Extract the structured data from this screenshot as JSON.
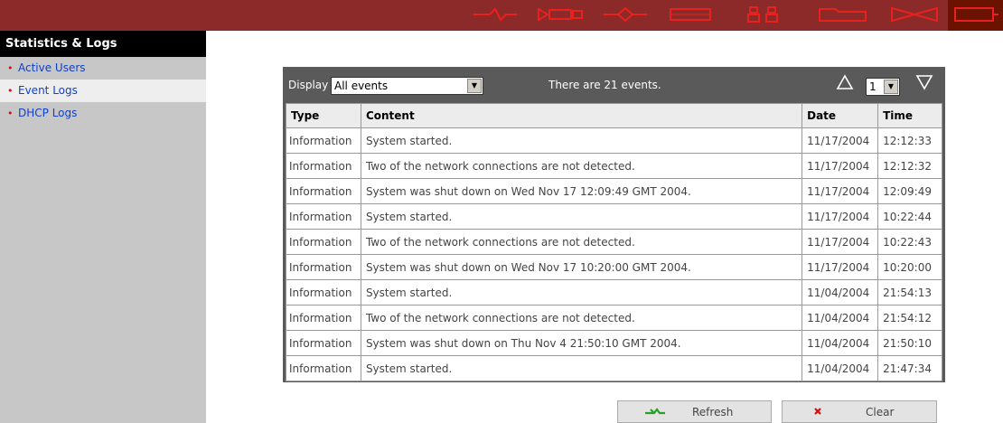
{
  "topnav": {
    "icons": [
      "network-plug-icon",
      "pipe-icon",
      "link-diamond-icon",
      "rectangle-bar-icon",
      "users-icon",
      "folder-icon",
      "bowtie-connector-icon",
      "monitor-icon"
    ],
    "icon_color": "#e8201e"
  },
  "sidebar": {
    "title": "Statistics & Logs",
    "items": [
      {
        "label": "Active Users"
      },
      {
        "label": "Event Logs"
      },
      {
        "label": "DHCP Logs"
      }
    ]
  },
  "toolbar": {
    "display_label": "Display",
    "display_value": "All events",
    "count_text": "There are 21 events.",
    "page_value": "1"
  },
  "table": {
    "headers": [
      "Type",
      "Content",
      "Date",
      "Time"
    ],
    "rows": [
      [
        "Information",
        "System started.",
        "11/17/2004",
        "12:12:33"
      ],
      [
        "Information",
        "Two of the network connections are not detected.",
        "11/17/2004",
        "12:12:32"
      ],
      [
        "Information",
        "System was shut down on Wed Nov 17 12:09:49 GMT 2004.",
        "11/17/2004",
        "12:09:49"
      ],
      [
        "Information",
        "System started.",
        "11/17/2004",
        "10:22:44"
      ],
      [
        "Information",
        "Two of the network connections are not detected.",
        "11/17/2004",
        "10:22:43"
      ],
      [
        "Information",
        "System was shut down on Wed Nov 17 10:20:00 GMT 2004.",
        "11/17/2004",
        "10:20:00"
      ],
      [
        "Information",
        "System started.",
        "11/04/2004",
        "21:54:13"
      ],
      [
        "Information",
        "Two of the network connections are not detected.",
        "11/04/2004",
        "21:54:12"
      ],
      [
        "Information",
        "System was shut down on Thu Nov 4 21:50:10 GMT 2004.",
        "11/04/2004",
        "21:50:10"
      ],
      [
        "Information",
        "System started.",
        "11/04/2004",
        "21:47:34"
      ]
    ]
  },
  "buttons": {
    "refresh_label": "Refresh",
    "clear_label": "Clear"
  },
  "colors": {
    "topbar": "#8b2a28",
    "sidebar": "#c7c7c7",
    "panel": "#5a5a5a",
    "link": "#1040d0",
    "bullet": "#d01010"
  }
}
